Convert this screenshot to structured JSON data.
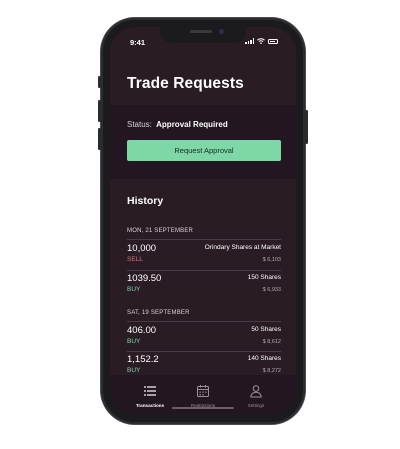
{
  "status_bar": {
    "time": "9:41"
  },
  "page": {
    "title": "Trade Requests"
  },
  "approval": {
    "status_label": "Status:",
    "status_value": "Approval Required",
    "button_label": "Request Approval"
  },
  "history": {
    "title": "History",
    "groups": [
      {
        "date": "MON, 21 SEPTEMBER",
        "transactions": [
          {
            "amount": "10,000",
            "side": "SELL",
            "description": "Orindary Shares at Market",
            "value": "$ 6,103"
          },
          {
            "amount": "1039.50",
            "side": "BUY",
            "description": "150 Shares",
            "value": "$ 6,933"
          }
        ]
      },
      {
        "date": "SAT, 19 SEPTEMBER",
        "transactions": [
          {
            "amount": "406.00",
            "side": "BUY",
            "description": "50 Shares",
            "value": "$ 8,612"
          },
          {
            "amount": "1,152.2",
            "side": "BUY",
            "description": "140 Shares",
            "value": "$ 8,272"
          }
        ]
      }
    ]
  },
  "tabs": [
    {
      "label": "Transactions",
      "icon": "list-icon",
      "active": true
    },
    {
      "label": "Restrictions",
      "icon": "calendar-icon",
      "active": false
    },
    {
      "label": "Settings",
      "icon": "person-icon",
      "active": false
    }
  ],
  "colors": {
    "background": "#2a1c25",
    "section": "#221720",
    "accent_green": "#7ed7a6",
    "sell_red": "#e0707a"
  }
}
